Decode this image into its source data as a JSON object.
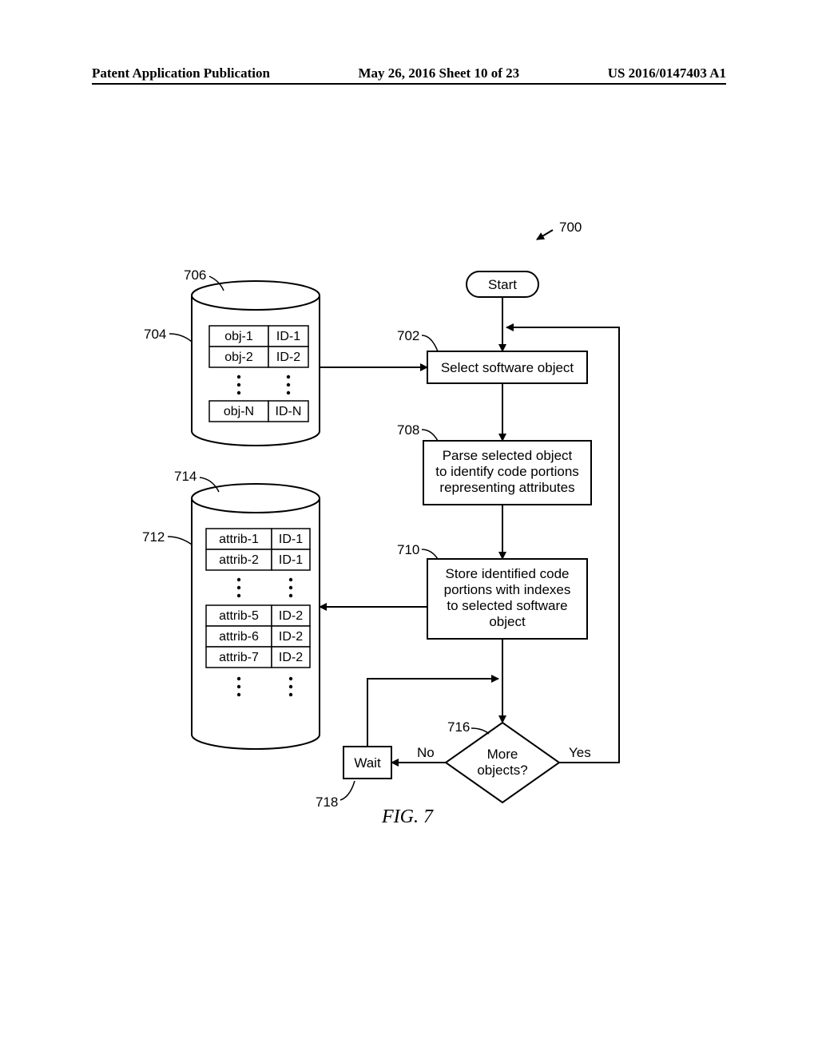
{
  "header": {
    "left": "Patent Application Publication",
    "center": "May 26, 2016  Sheet 10 of 23",
    "right": "US 2016/0147403 A1"
  },
  "refs": {
    "r700": "700",
    "r702": "702",
    "r704": "704",
    "r706": "706",
    "r708": "708",
    "r710": "710",
    "r712": "712",
    "r714": "714",
    "r716": "716",
    "r718": "718"
  },
  "flow": {
    "start": "Start",
    "step702": "Select software object",
    "step708_l1": "Parse selected object",
    "step708_l2": "to identify code portions",
    "step708_l3": "representing attributes",
    "step710_l1": "Store identified code",
    "step710_l2": "portions with indexes",
    "step710_l3": "to selected software",
    "step710_l4": "object",
    "dec_l1": "More",
    "dec_l2": "objects?",
    "yes": "Yes",
    "no": "No",
    "wait": "Wait"
  },
  "db1": {
    "r1c1": "obj-1",
    "r1c2": "ID-1",
    "r2c1": "obj-2",
    "r2c2": "ID-2",
    "rNc1": "obj-N",
    "rNc2": "ID-N"
  },
  "db2": {
    "r1c1": "attrib-1",
    "r1c2": "ID-1",
    "r2c1": "attrib-2",
    "r2c2": "ID-1",
    "r5c1": "attrib-5",
    "r5c2": "ID-2",
    "r6c1": "attrib-6",
    "r6c2": "ID-2",
    "r7c1": "attrib-7",
    "r7c2": "ID-2"
  },
  "figure": "FIG.  7"
}
